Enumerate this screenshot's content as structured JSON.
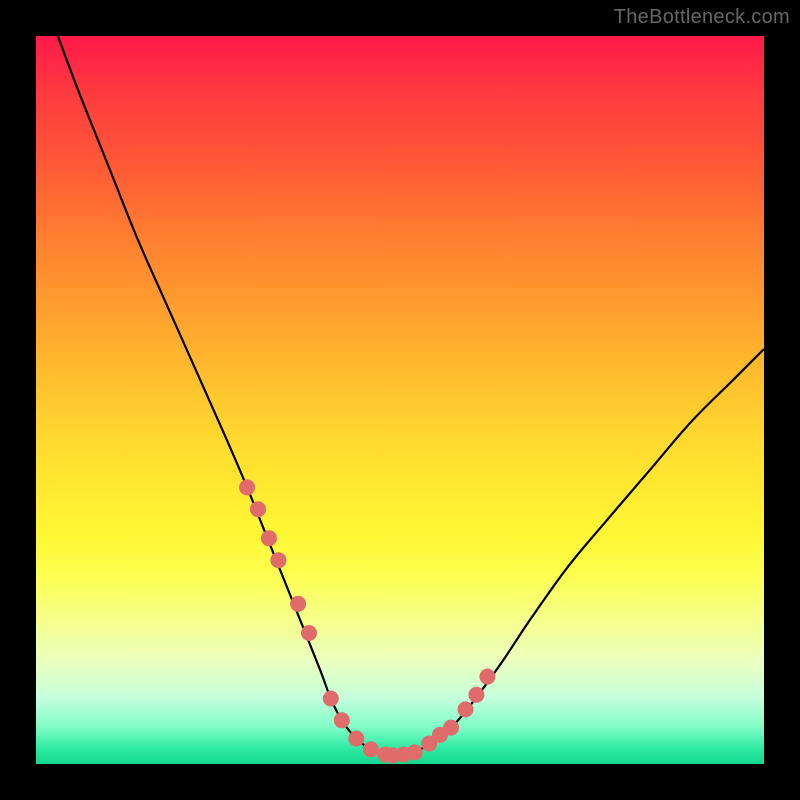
{
  "watermark": "TheBottleneck.com",
  "chart_data": {
    "type": "line",
    "title": "",
    "xlabel": "",
    "ylabel": "",
    "xlim": [
      0,
      100
    ],
    "ylim": [
      0,
      100
    ],
    "curve": {
      "name": "bottleneck-curve",
      "x": [
        3,
        6,
        10,
        14,
        18,
        22,
        26,
        29,
        31,
        33,
        35,
        37,
        39,
        40.5,
        42,
        44,
        46,
        48,
        50,
        52,
        54,
        57,
        60,
        64,
        68,
        73,
        78,
        84,
        90,
        96,
        100
      ],
      "y": [
        100,
        92,
        82,
        72,
        63,
        54,
        45,
        38,
        33,
        28,
        23,
        18,
        13,
        9,
        6,
        3.5,
        2,
        1.3,
        1.2,
        1.6,
        2.8,
        5,
        8.5,
        14,
        20,
        27,
        33,
        40,
        47,
        53,
        57
      ]
    },
    "markers": {
      "name": "highlight-points",
      "color": "#e06b6b",
      "radius_px": 8,
      "x": [
        29,
        30.5,
        32,
        33.3,
        36,
        37.5,
        40.5,
        42,
        44,
        46,
        48,
        49,
        50.5,
        52,
        54,
        55.5,
        57,
        59,
        60.5,
        62
      ],
      "y": [
        38,
        35,
        31,
        28,
        22,
        18,
        9,
        6,
        3.5,
        2,
        1.3,
        1.2,
        1.3,
        1.6,
        2.8,
        4,
        5,
        7.5,
        9.5,
        12
      ]
    }
  }
}
